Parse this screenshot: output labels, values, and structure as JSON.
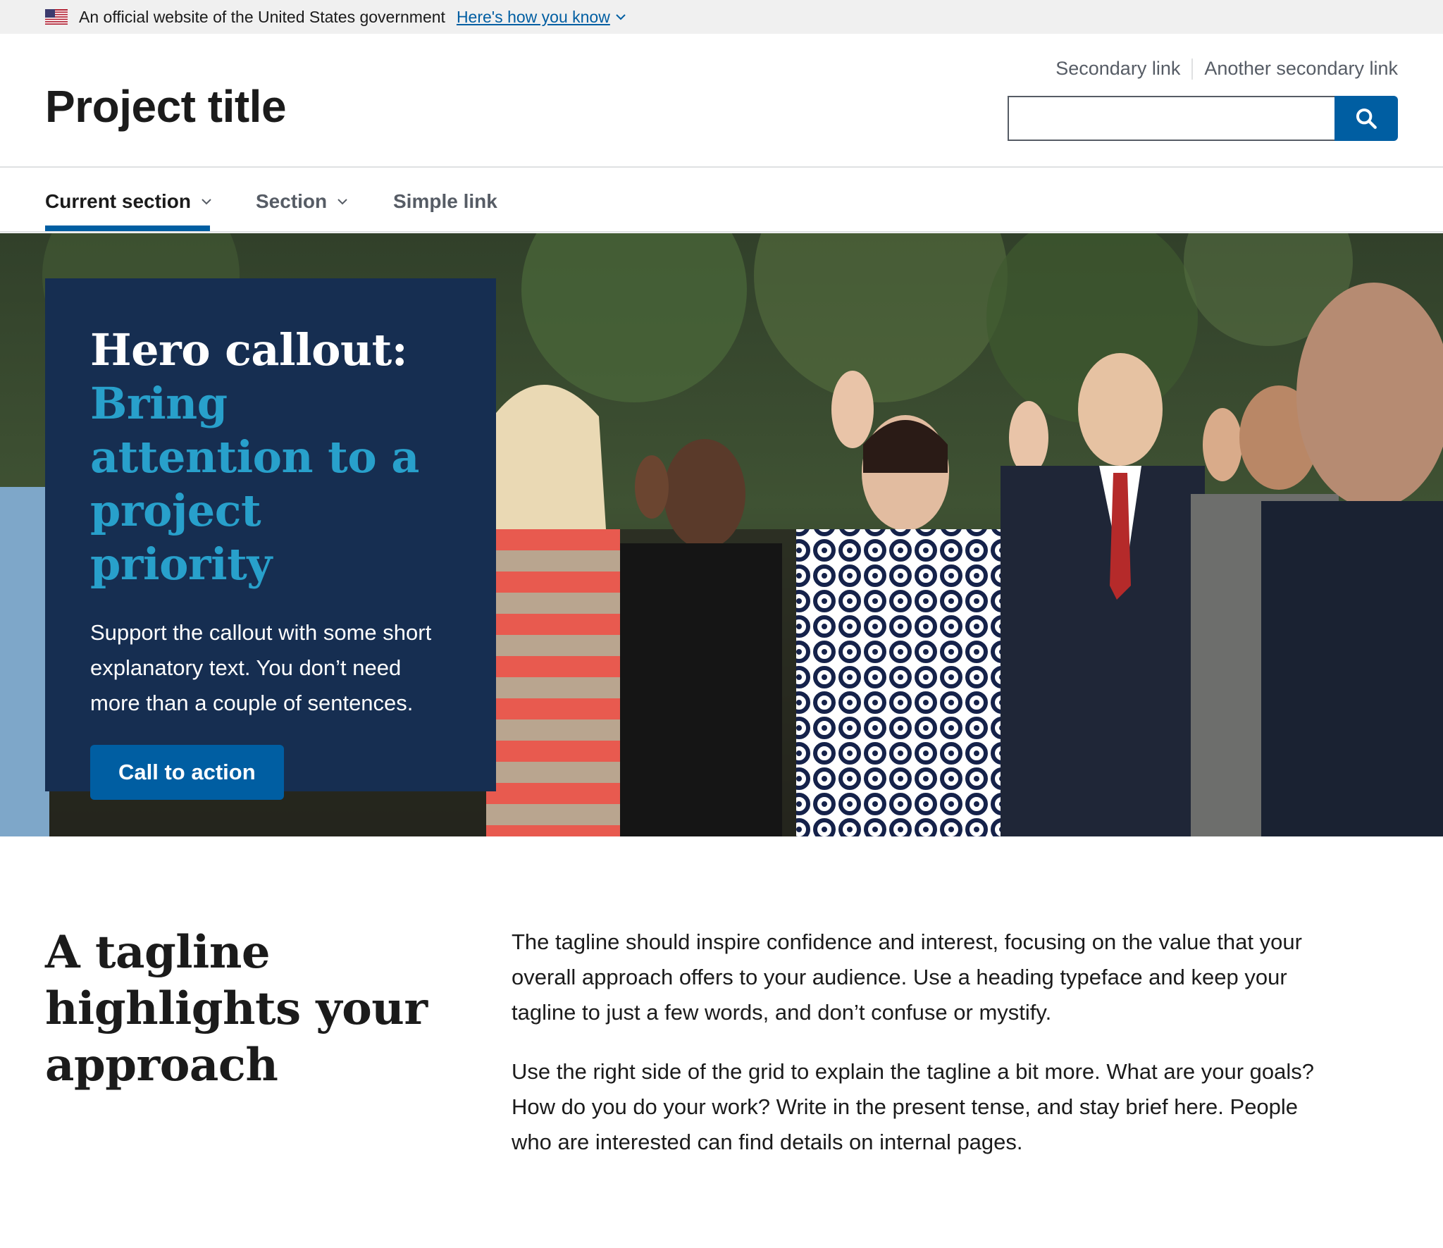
{
  "gov_banner": {
    "text": "An official website of the United States government",
    "link": "Here's how you know"
  },
  "header": {
    "title": "Project title",
    "secondary_links": [
      "Secondary link",
      "Another secondary link"
    ],
    "search_value": ""
  },
  "nav": {
    "items": [
      {
        "label": "Current section",
        "has_dropdown": true,
        "current": true
      },
      {
        "label": "Section",
        "has_dropdown": true,
        "current": false
      },
      {
        "label": "Simple link",
        "has_dropdown": false,
        "current": false
      }
    ]
  },
  "hero": {
    "title_lead": "Hero callout:",
    "title_accent": "Bring attention to a project priority",
    "text": "Support the callout with some short explanatory text. You don’t need more than a couple of sentences.",
    "cta": "Call to action"
  },
  "tagline": {
    "heading": "A tagline highlights your approach",
    "paragraphs": [
      "The tagline should inspire confidence and interest, focusing on the value that your overall approach offers to your audience. Use a heading typeface and keep your tagline to just a few words, and don’t confuse or mystify.",
      "Use the right side of the grid to explain the tagline a bit more. What are your goals? How do you do your work? Write in the present tense, and stay brief here. People who are interested can find details on internal pages."
    ]
  },
  "colors": {
    "primary": "#005ea2",
    "callout_bg": "#162e51",
    "accent_cyan": "#28a0cb",
    "banner_bg": "#f0f0f0",
    "text_muted": "#565c65"
  },
  "icons": {
    "flag": "us-flag-icon",
    "banner_chevron": "chevron-down-icon",
    "search": "search-icon",
    "nav_chevron": "chevron-down-icon"
  }
}
